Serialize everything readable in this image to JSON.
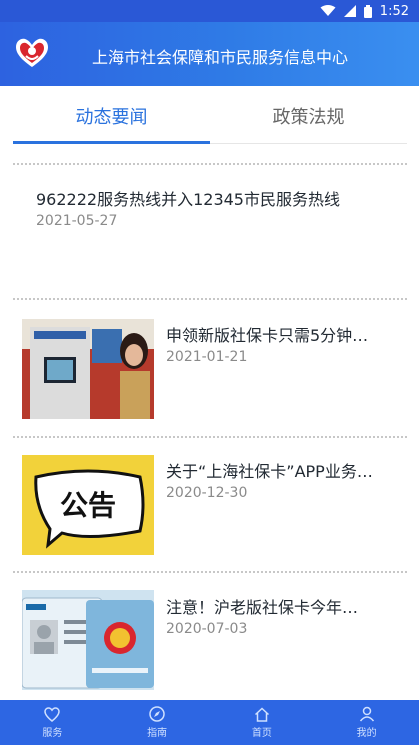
{
  "status_bar": {
    "time": "1:52"
  },
  "header": {
    "title": "上海市社会保障和市民服务信息中心"
  },
  "tabs": [
    {
      "label": "动态要闻",
      "active": true
    },
    {
      "label": "政策法规",
      "active": false
    }
  ],
  "news": [
    {
      "title": "962222服务热线并入12345市民服务热线",
      "date": "2021-05-27"
    },
    {
      "title": "申领新版社保卡只需5分钟…",
      "date": "2021-01-21",
      "thumb": "kiosk-photo"
    },
    {
      "title": "关于“上海社保卡”APP业务…",
      "date": "2020-12-30",
      "thumb_text": "公告"
    },
    {
      "title": "注意！沪老版社保卡今年…",
      "date": "2020-07-03",
      "thumb": "social-security-card"
    }
  ],
  "bottom_nav": [
    {
      "label": "服务",
      "icon": "heart-icon"
    },
    {
      "label": "指南",
      "icon": "compass-icon"
    },
    {
      "label": "首页",
      "icon": "home-icon"
    },
    {
      "label": "我的",
      "icon": "user-icon"
    }
  ],
  "colors": {
    "primary": "#2d62e0",
    "accent": "#2a72de",
    "logo_red": "#d9262e"
  }
}
